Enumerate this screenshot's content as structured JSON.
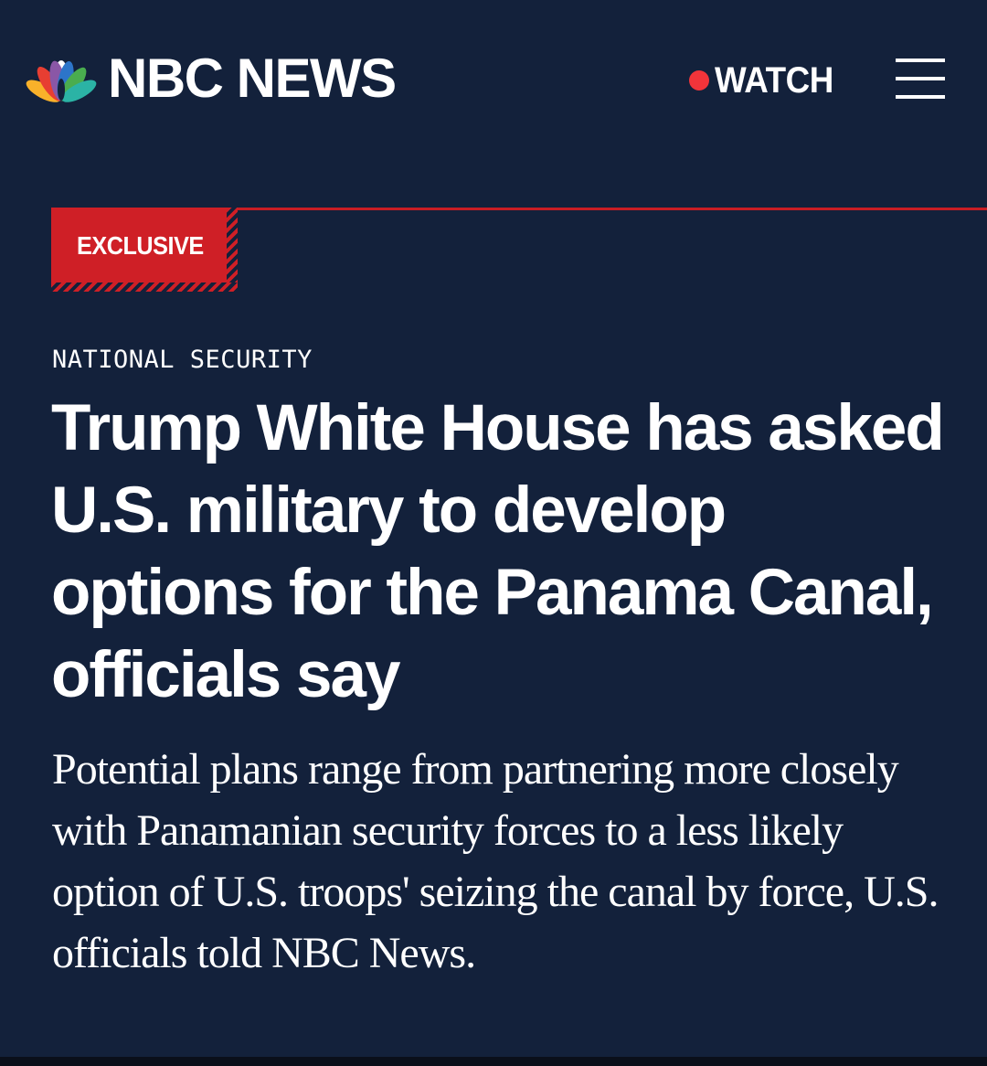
{
  "header": {
    "brand": "NBC NEWS",
    "watch_label": "WATCH",
    "logo_icon": "nbc-peacock-icon",
    "menu_icon": "hamburger-menu-icon"
  },
  "article": {
    "badge": "EXCLUSIVE",
    "kicker": "NATIONAL SECURITY",
    "headline": "Trump White House has asked U.S. military to develop options for the Panama Canal, officials say",
    "dek": "Potential plans range from partnering more closely with Panamanian security forces to a less likely option of U.S. troops' seizing the canal by force, U.S. officials told NBC News."
  },
  "colors": {
    "background": "#13213b",
    "accent_red": "#cf1f26",
    "live_dot": "#f2343a",
    "text": "#ffffff"
  }
}
